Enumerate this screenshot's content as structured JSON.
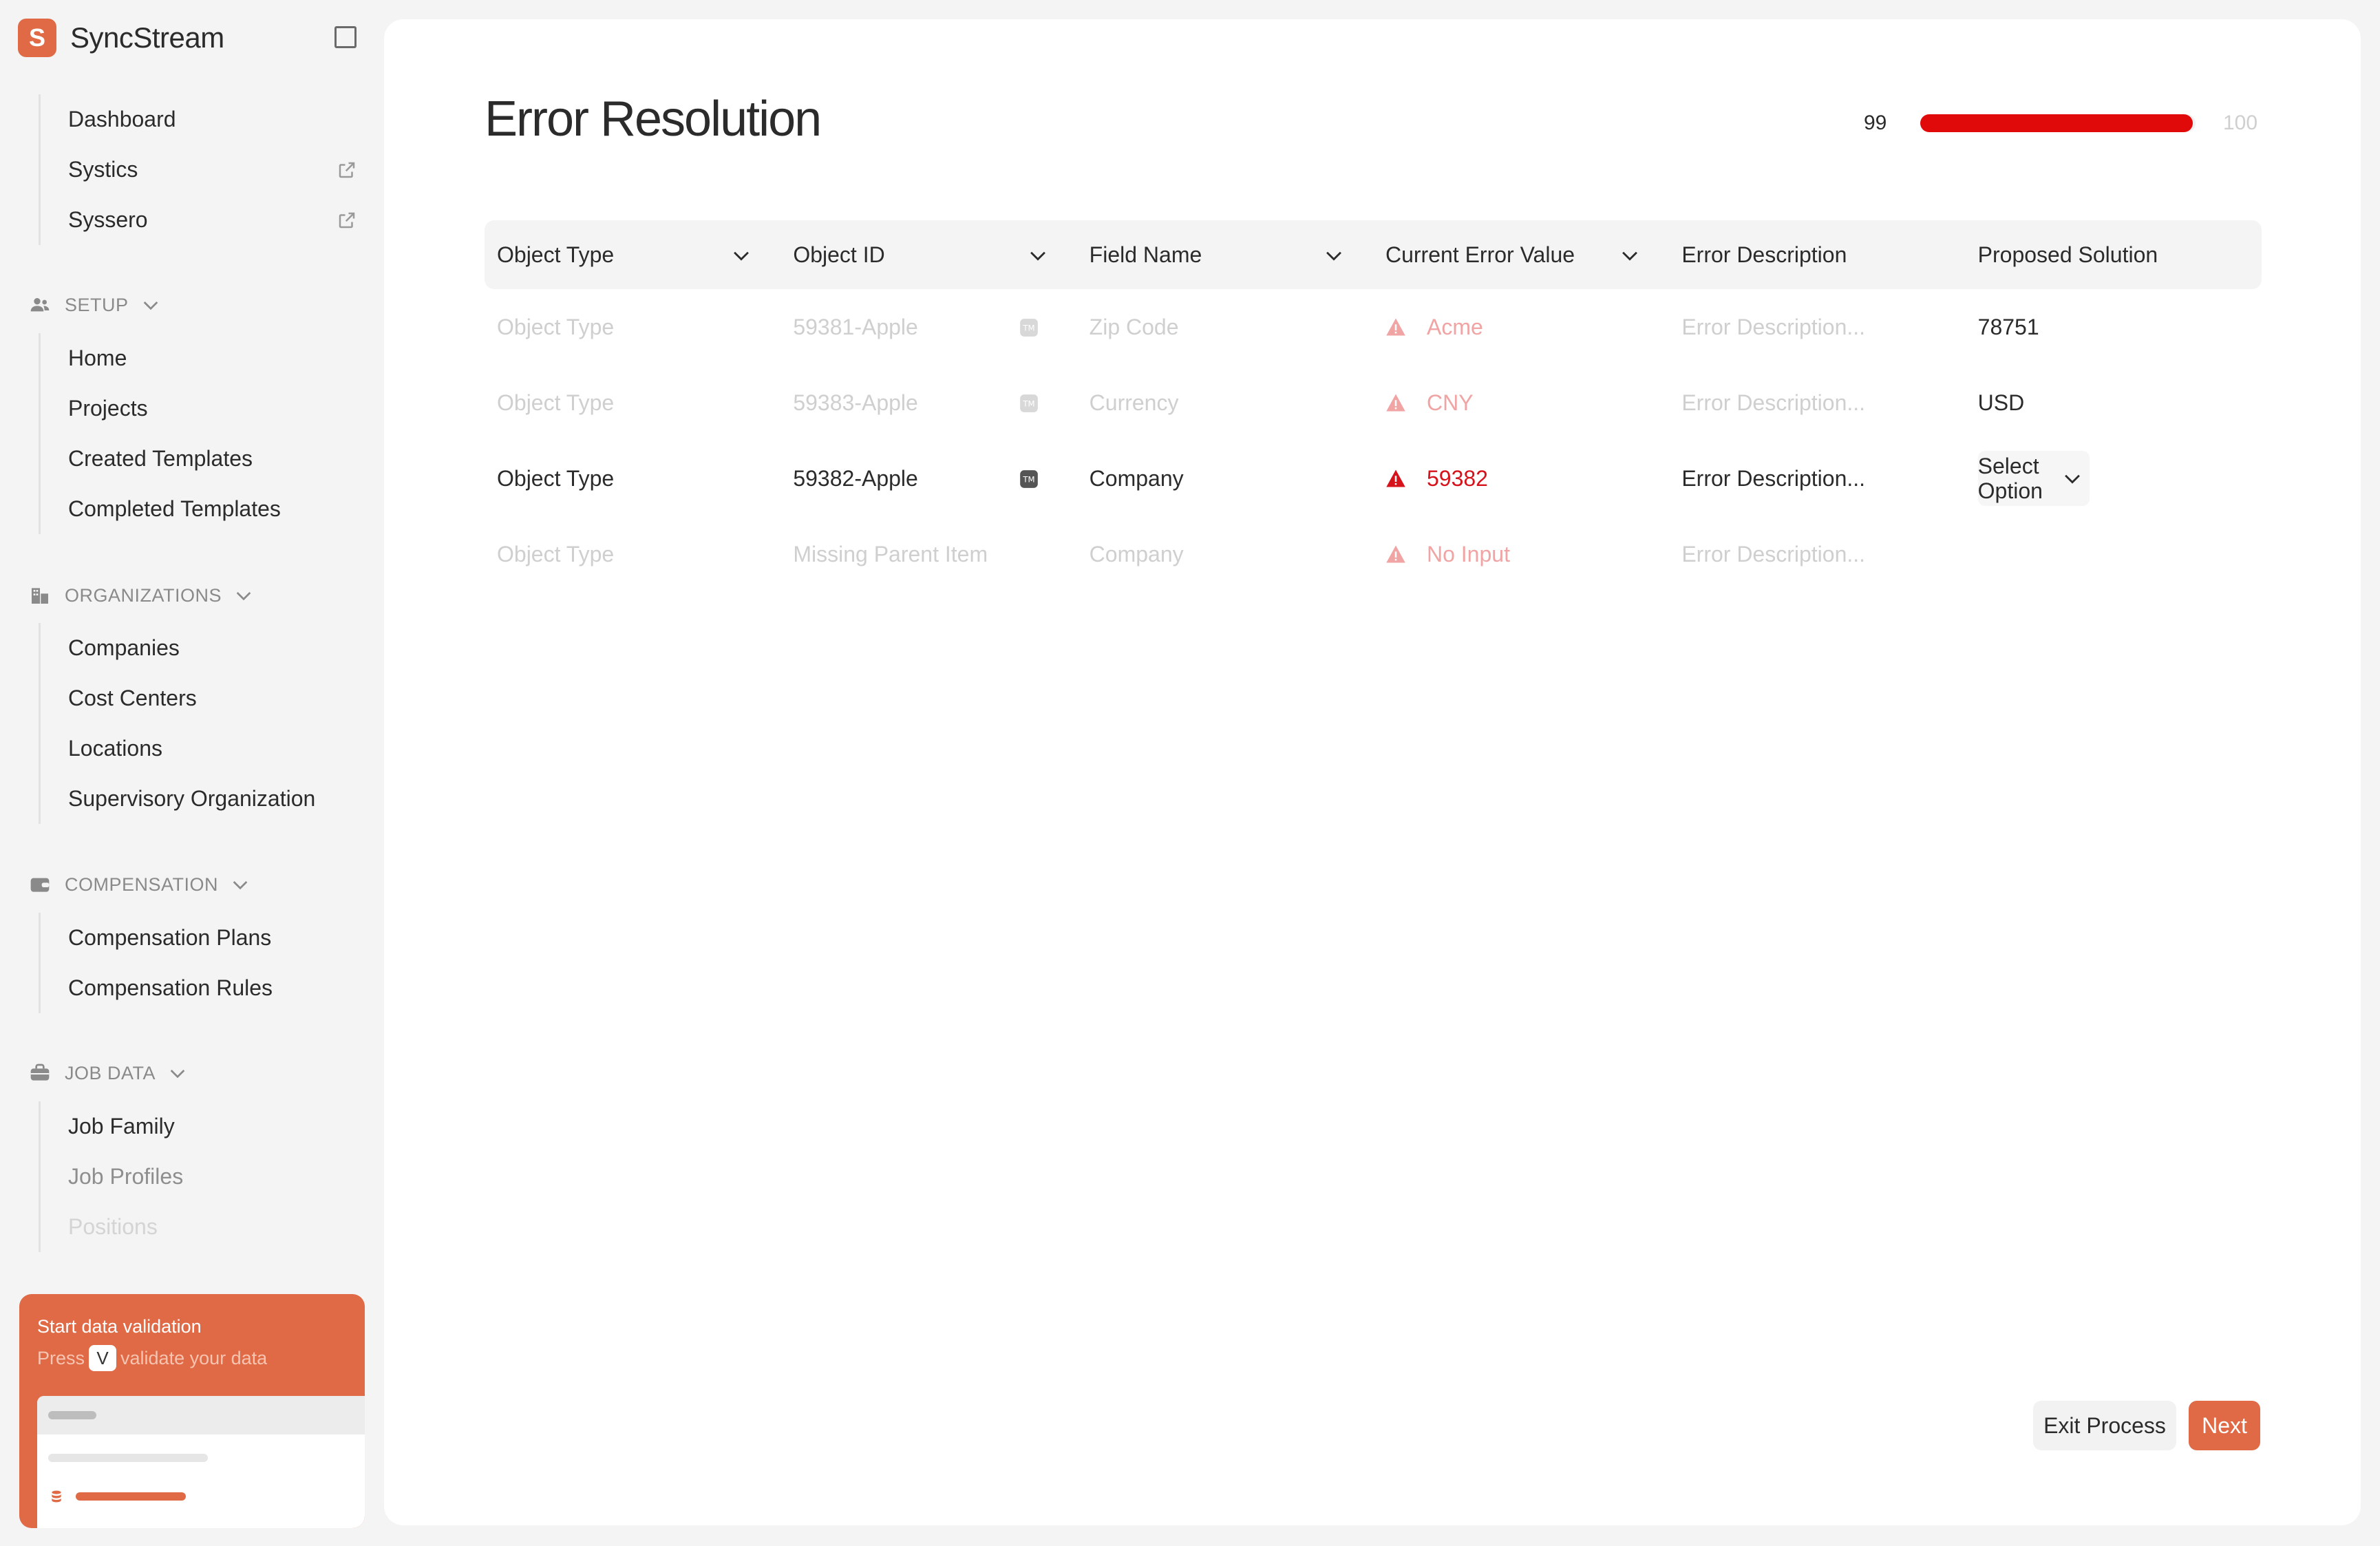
{
  "app": {
    "name": "SyncStream",
    "logo_letter": "S",
    "accent": "#e06a45"
  },
  "nav": {
    "top_items": [
      {
        "label": "Dashboard",
        "external": false
      },
      {
        "label": "Systics",
        "external": true
      },
      {
        "label": "Syssero",
        "external": true
      }
    ],
    "sections": [
      {
        "title": "SETUP",
        "icon": "users-icon",
        "items": [
          "Home",
          "Projects",
          "Created Templates",
          "Completed Templates"
        ]
      },
      {
        "title": "ORGANIZATIONS",
        "icon": "building-icon",
        "items": [
          "Companies",
          "Cost Centers",
          "Locations",
          "Supervisory Organization"
        ]
      },
      {
        "title": "COMPENSATION",
        "icon": "wallet-icon",
        "items": [
          "Compensation Plans",
          "Compensation Rules"
        ]
      },
      {
        "title": "JOB DATA",
        "icon": "briefcase-icon",
        "items": [
          "Job Family",
          "Job Profiles",
          "Positions"
        ]
      }
    ]
  },
  "promo": {
    "title": "Start data validation",
    "prefix": "Press",
    "key": "V",
    "suffix": "validate your data"
  },
  "page": {
    "title": "Error Resolution"
  },
  "progress": {
    "current": "99",
    "max": "100",
    "fraction": 0.99,
    "color": "#e00a0a"
  },
  "table": {
    "headers": [
      "Object Type",
      "Object ID",
      "Field Name",
      "Current Error Value",
      "Error Description",
      "Proposed Solution"
    ],
    "rows": [
      {
        "object_type": "Object Type",
        "object_id": "59381-Apple",
        "field": "Zip Code",
        "error_value": "Acme",
        "description": "Error Description...",
        "solution": "78751",
        "dim": true
      },
      {
        "object_type": "Object Type",
        "object_id": "59383-Apple",
        "field": "Currency",
        "error_value": "CNY",
        "description": "Error Description...",
        "solution": "USD",
        "dim": true
      },
      {
        "object_type": "Object Type",
        "object_id": "59382-Apple",
        "field": "Company",
        "error_value": "59382",
        "description": "Error Description...",
        "solution_select": "Select Option",
        "dim": false
      },
      {
        "object_type": "Object Type",
        "object_id": "Missing Parent Item",
        "field": "Company",
        "error_value": "No Input",
        "description": "Error Description...",
        "dim": true
      }
    ]
  },
  "actions": {
    "exit": "Exit Process",
    "next": "Next"
  }
}
